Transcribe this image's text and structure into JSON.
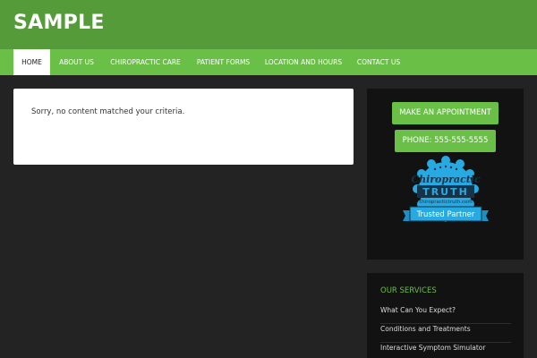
{
  "site": {
    "title": "SAMPLE"
  },
  "nav": {
    "items": [
      {
        "label": "HOME"
      },
      {
        "label": "ABOUT US"
      },
      {
        "label": "CHIROPRACTIC CARE"
      },
      {
        "label": "PATIENT FORMS"
      },
      {
        "label": "LOCATION AND HOURS"
      },
      {
        "label": "CONTACT US"
      }
    ]
  },
  "main": {
    "message": "Sorry, no content matched your criteria."
  },
  "sidebar": {
    "appointment_label": "MAKE AN APPOINTMENT",
    "phone_label": "PHONE: 555-555-5555",
    "badge": {
      "line1": "Chiropractic",
      "line2": "TRUTH",
      "url": "chiropractictruth.com",
      "ribbon": "Trusted Partner"
    },
    "services": {
      "title": "OUR SERVICES",
      "items": [
        {
          "label": "What Can You Expect?"
        },
        {
          "label": "Conditions and Treatments"
        },
        {
          "label": "Interactive Symptom Simulator"
        }
      ]
    }
  },
  "colors": {
    "header": "#559b3a",
    "nav": "#6abf47",
    "accent": "#6abf47",
    "background": "#232323",
    "widget": "#121212",
    "badge": "#27a9e1"
  }
}
